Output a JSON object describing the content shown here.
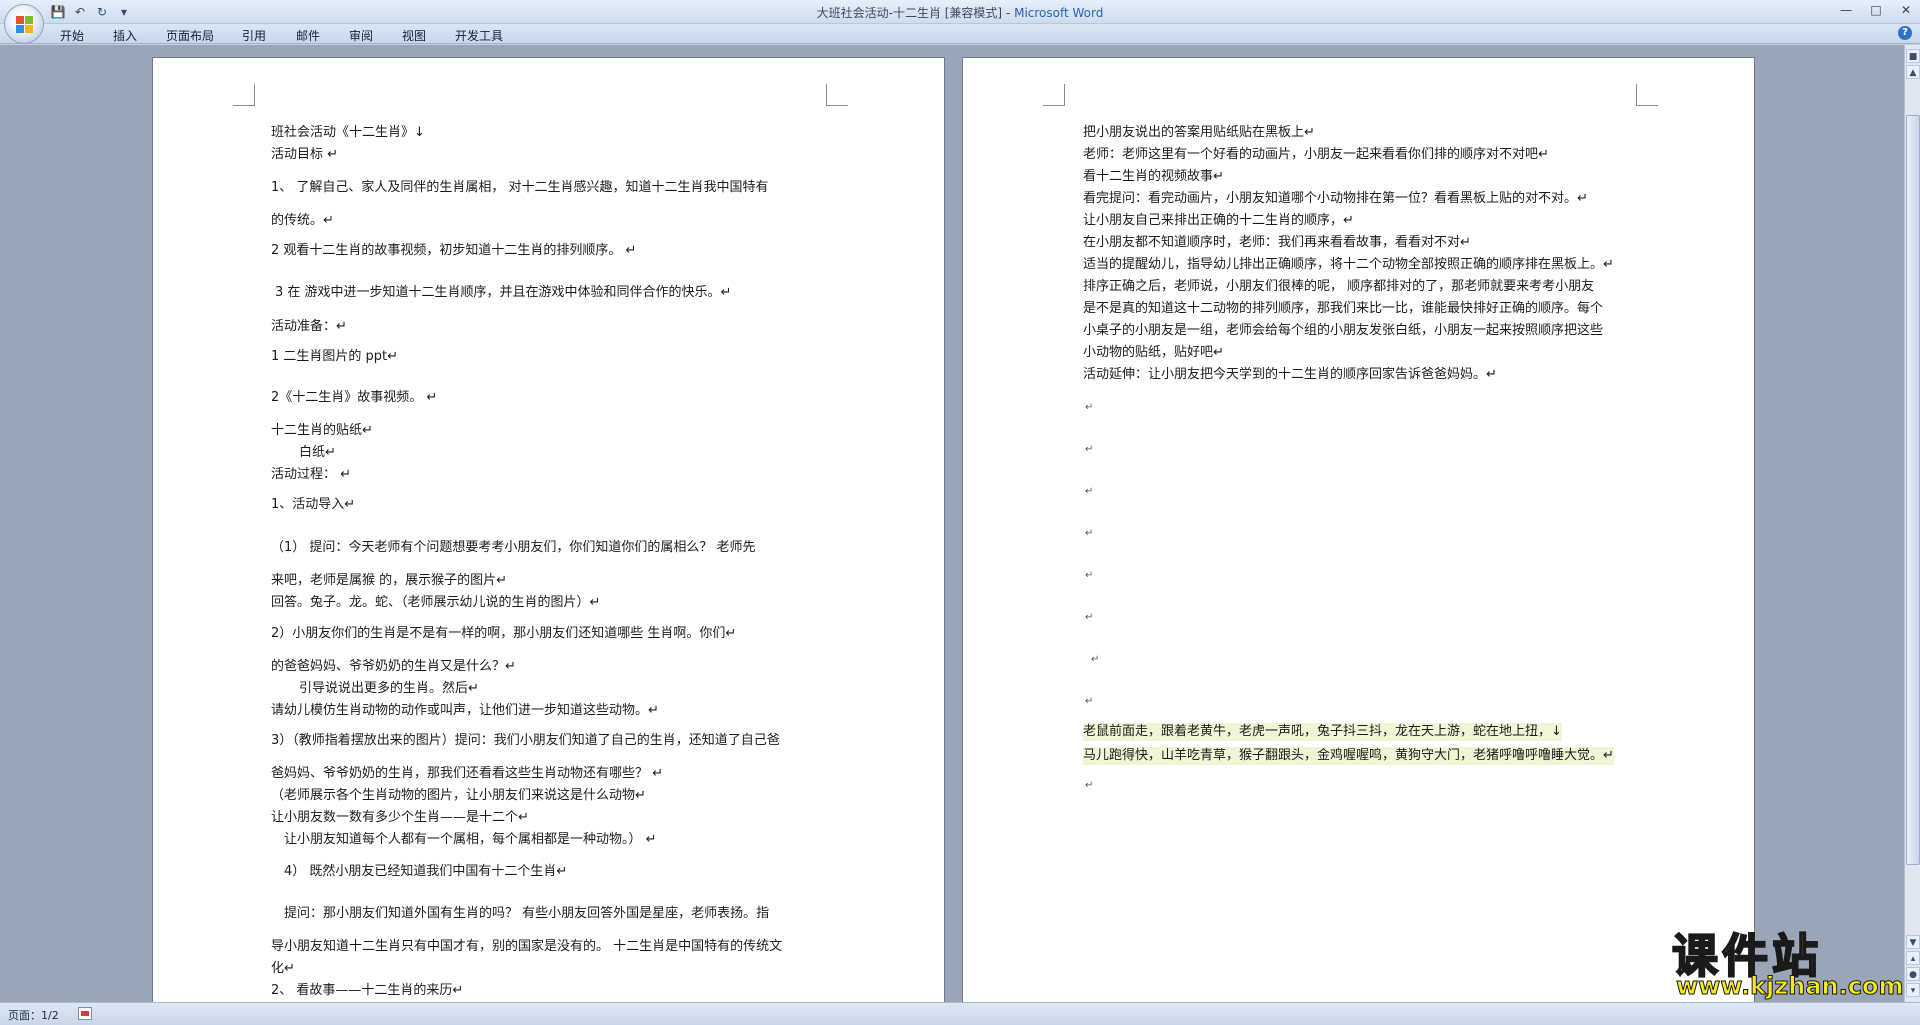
{
  "window": {
    "title_doc": "大班社会活动-十二生肖 [兼容模式]",
    "title_sep": " - ",
    "title_app": "Microsoft Word"
  },
  "ribbon": {
    "tabs": [
      "开始",
      "插入",
      "页面布局",
      "引用",
      "邮件",
      "审阅",
      "视图",
      "开发工具"
    ]
  },
  "page1": {
    "lines": [
      "班社会活动《十二生肖》↓",
      "活动目标        ↵",
      "1、  了解自己、家人及同伴的生肖属相，   对十二生肖感兴趣，知道十二生肖我中国特有",
      "的传统。↵",
      "2 观看十二生肖的故事视频，初步知道十二生肖的排列顺序。      ↵",
      "3 在 游戏中进一步知道十二生肖顺序，并且在游戏中体验和同伴合作的快乐。↵",
      "活动准备：↵",
      "1 二生肖图片的 ppt↵",
      "2《十二生肖》故事视频。    ↵",
      "十二生肖的贴纸↵",
      "白纸↵",
      "活动过程：      ↵",
      "1、活动导入↵",
      "（1）   提问：今天老师有个问题想要考考小朋友们，你们知道你们的属相么？     老师先",
      "来吧，老师是属猴 的，展示猴子的图片↵",
      "回答。兔子。龙。蛇、（老师展示幼儿说的生肖的图片）↵",
      "2）小朋友你们的生肖是不是有一样的啊，那小朋友们还知道哪些 生肖啊。你们↵",
      "的爸爸妈妈、爷爷奶奶的生肖又是什么？↵",
      "引导说说出更多的生肖。然后↵",
      "请幼儿模仿生肖动物的动作或叫声，让他们进一步知道这些动物。↵",
      "3）（教师指着摆放出来的图片）提问：我们小朋友们知道了自己的生肖，还知道了自己爸",
      "爸妈妈、爷爷奶奶的生肖，那我们还看看这些生肖动物还有哪些？  ↵",
      "（老师展示各个生肖动物的图片，让小朋友们来说这是什么动物↵",
      "让小朋友数一数有多少个生肖——是十二个↵",
      "让小朋友知道每个人都有一个属相，每个属相都是一种动物。）      ↵",
      "4） 既然小朋友已经知道我们中国有十二个生肖↵",
      "提问：那小朋友们知道外国有生肖的吗？    有些小朋友回答外国是星座，老师表扬。指",
      "导小朋友知道十二生肖只有中国才有，别的国家是没有的。   十二生肖是中国特有的传统文",
      "化↵",
      "2、      看故事——十二生肖的来历↵"
    ]
  },
  "page2": {
    "lines": [
      "把小朋友说出的答案用贴纸贴在黑板上↵",
      "老师：老师这里有一个好看的动画片，小朋友一起来看看你们排的顺序对不对吧↵",
      "看十二生肖的视频故事↵",
      "看完提问：看完动画片，小朋友知道哪个小动物排在第一位？看看黑板上贴的对不对。↵",
      "让小朋友自己来排出正确的十二生肖的顺序，↵",
      "在小朋友都不知道顺序时，老师：我们再来看看故事，看看对不对↵",
      "适当的提醒幼儿，指导幼儿排出正确顺序，将十二个动物全部按照正确的顺序排在黑板上。↵",
      "排序正确之后，老师说，小朋友们很棒的呢， 顺序都排对的了，那老师就要来考考小朋友",
      "是不是真的知道这十二动物的排列顺序，那我们来比一比，谁能最快排好正确的顺序。每个",
      "小桌子的小朋友是一组，老师会给每个组的小朋友发张白纸，小朋友一起来按照顺序把这些",
      "小动物的贴纸，贴好吧↵",
      "活动延伸：让小朋友把今天学到的十二生肖的顺序回家告诉爸爸妈妈。↵",
      "老鼠前面走，跟着老黄牛，老虎一声吼，兔子抖三抖，龙在天上游，蛇在地上扭，↓",
      "马儿跑得快，山羊吃青草，猴子翻跟头，金鸡喔喔鸣，黄狗守大门，老猪呼噜呼噜睡大觉。↵"
    ],
    "para_mark": "↵"
  },
  "statusbar": {
    "page_info": "页面：1/2"
  },
  "watermark": {
    "cn": "课件站",
    "url": "www.kjzhan.com"
  },
  "colors": {
    "accent": "#2a64b8",
    "highlight": "#eef6d6",
    "watermark": "#f5ea18"
  }
}
